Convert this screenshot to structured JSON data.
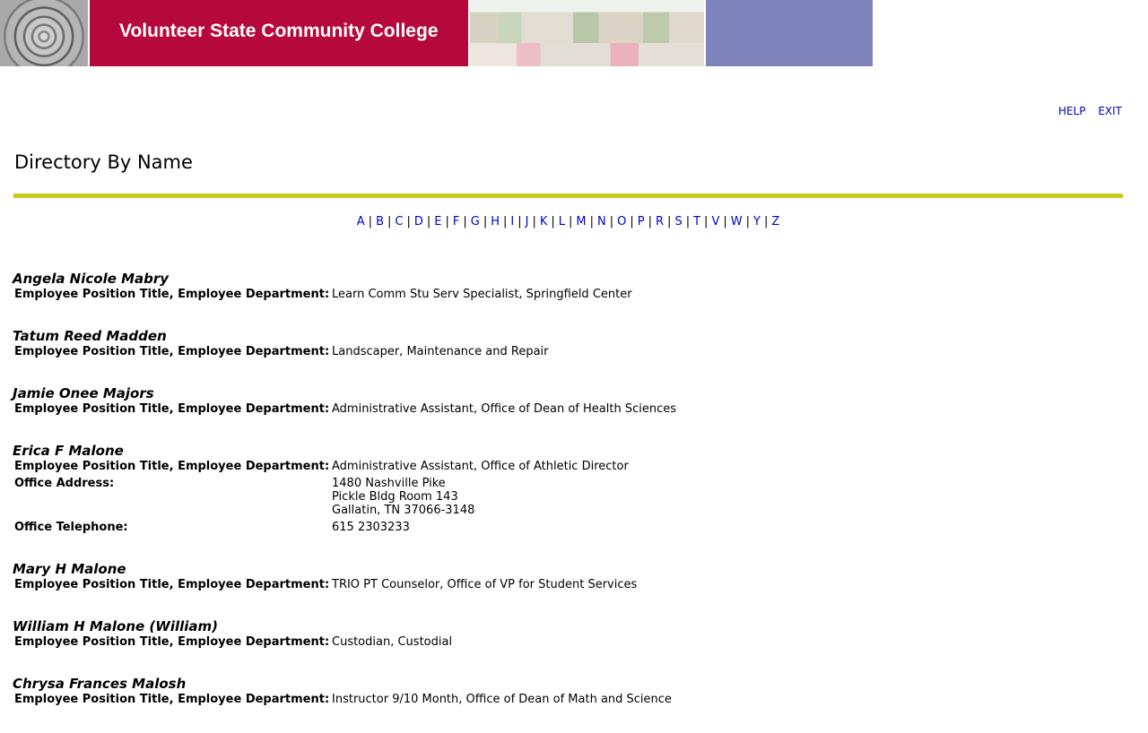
{
  "banner": {
    "title": "Volunteer State Community College"
  },
  "toplinks": {
    "help": "HELP",
    "exit": "EXIT"
  },
  "page_title": "Directory By Name",
  "alphabet": [
    "A",
    "B",
    "C",
    "D",
    "E",
    "F",
    "G",
    "H",
    "I",
    "J",
    "K",
    "L",
    "M",
    "N",
    "O",
    "P",
    "R",
    "S",
    "T",
    "V",
    "W",
    "Y",
    "Z"
  ],
  "alphabet_separator": "|",
  "entries": [
    {
      "name": "Angela Nicole Mabry",
      "rows": [
        {
          "label": "Employee Position Title, Employee Department:",
          "value": "Learn Comm Stu Serv Specialist, Springfield Center"
        }
      ]
    },
    {
      "name": "Tatum Reed Madden",
      "rows": [
        {
          "label": "Employee Position Title, Employee Department:",
          "value": "Landscaper, Maintenance and Repair"
        }
      ]
    },
    {
      "name": "Jamie Onee Majors",
      "rows": [
        {
          "label": "Employee Position Title, Employee Department:",
          "value": "Administrative Assistant, Office of Dean of Health Sciences"
        }
      ]
    },
    {
      "name": "Erica F Malone",
      "rows": [
        {
          "label": "Employee Position Title, Employee Department:",
          "value": "Administrative Assistant, Office of Athletic Director"
        },
        {
          "label": "Office Address:",
          "value": "1480 Nashville Pike\nPickle Bldg Room 143\nGallatin, TN 37066-3148"
        },
        {
          "label": "Office Telephone:",
          "value": "615 2303233"
        }
      ]
    },
    {
      "name": "Mary H Malone",
      "rows": [
        {
          "label": "Employee Position Title, Employee Department:",
          "value": "TRIO PT Counselor, Office of VP for Student Services"
        }
      ]
    },
    {
      "name": "William H Malone (William)",
      "rows": [
        {
          "label": "Employee Position Title, Employee Department:",
          "value": "Custodian, Custodial"
        }
      ]
    },
    {
      "name": "Chrysa Frances Malosh",
      "rows": [
        {
          "label": "Employee Position Title, Employee Department:",
          "value": "Instructor 9/10 Month, Office of Dean of Math and Science"
        }
      ]
    }
  ]
}
